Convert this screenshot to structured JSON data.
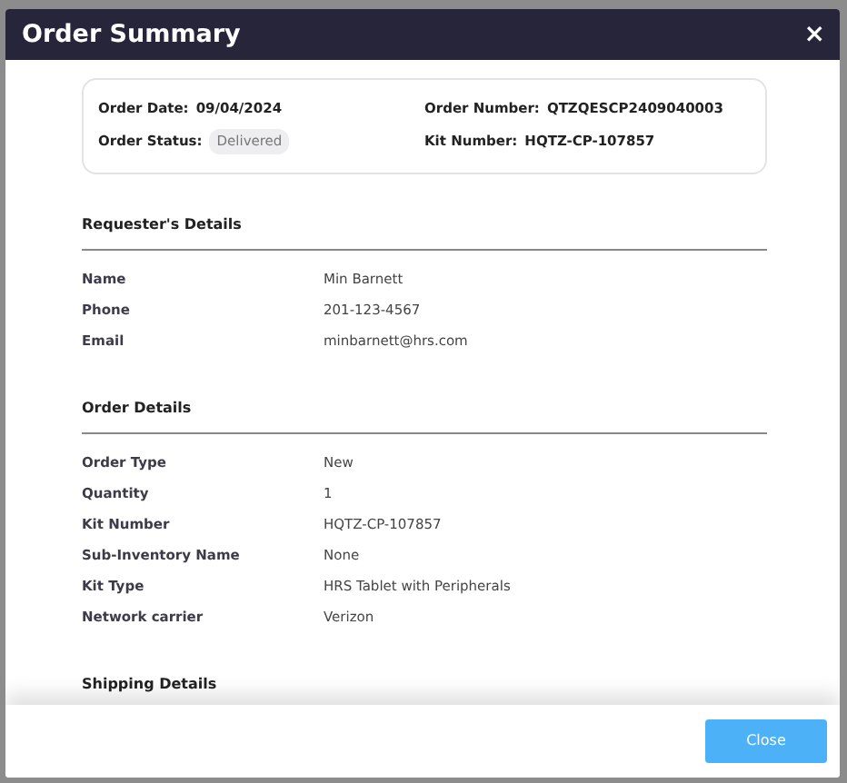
{
  "modal": {
    "title": "Order Summary",
    "close_symbol": "×"
  },
  "summary": {
    "left": [
      {
        "label": "Order Date:",
        "value": "09/04/2024"
      },
      {
        "label": "Order Status:",
        "value": "Delivered",
        "kind": "badge"
      }
    ],
    "right": [
      {
        "label": "Order Number:",
        "value": "QTZQESCP2409040003"
      },
      {
        "label": "Kit Number:",
        "value": "HQTZ-CP-107857"
      }
    ]
  },
  "sections": [
    {
      "title": "Requester's Details",
      "rows": [
        {
          "label": "Name",
          "value": "Min Barnett"
        },
        {
          "label": "Phone",
          "value": "201-123-4567"
        },
        {
          "label": "Email",
          "value": "minbarnett@hrs.com"
        }
      ]
    },
    {
      "title": "Order Details",
      "rows": [
        {
          "label": "Order Type",
          "value": "New"
        },
        {
          "label": "Quantity",
          "value": "1"
        },
        {
          "label": "Kit Number",
          "value": "HQTZ-CP-107857"
        },
        {
          "label": "Sub-Inventory Name",
          "value": "None"
        },
        {
          "label": "Kit Type",
          "value": "HRS Tablet with Peripherals"
        },
        {
          "label": "Network carrier",
          "value": "Verizon"
        }
      ]
    },
    {
      "title": "Shipping Details"
    }
  ],
  "footer": {
    "button": "Close"
  }
}
